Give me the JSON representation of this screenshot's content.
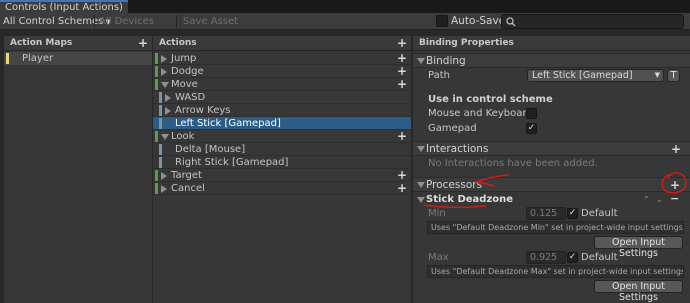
{
  "window": {
    "tab_title": "Controls (Input Actions)"
  },
  "toolbar": {
    "control_schemes": "All Control Schemes",
    "devices": "All Devices",
    "save_asset": "Save Asset",
    "auto_save": "Auto-Save",
    "auto_save_checked": false,
    "search_value": ""
  },
  "action_maps": {
    "title": "Action Maps",
    "items": [
      {
        "label": "Player",
        "color": "#e3dc7a"
      }
    ]
  },
  "actions": {
    "title": "Actions",
    "rows": [
      {
        "label": "Jump",
        "kind": "action",
        "expanded": false,
        "bar": "#5e9c4e"
      },
      {
        "label": "Dodge",
        "kind": "action",
        "expanded": false,
        "bar": "#5e9c4e"
      },
      {
        "label": "Move",
        "kind": "action",
        "expanded": true,
        "bar": "#5e9c4e"
      },
      {
        "label": "WASD",
        "kind": "composite",
        "expanded": false,
        "bar": "#7a95a6"
      },
      {
        "label": "Arrow Keys",
        "kind": "composite",
        "expanded": false,
        "bar": "#7a95a6"
      },
      {
        "label": "Left Stick [Gamepad]",
        "kind": "binding",
        "selected": true,
        "bar": "#7a95a6"
      },
      {
        "label": "Look",
        "kind": "action",
        "expanded": true,
        "bar": "#5e9c4e"
      },
      {
        "label": "Delta [Mouse]",
        "kind": "binding",
        "bar": "#7a95a6"
      },
      {
        "label": "Right Stick [Gamepad]",
        "kind": "binding",
        "bar": "#7a95a6"
      },
      {
        "label": "Target",
        "kind": "action",
        "expanded": false,
        "bar": "#5e9c4e"
      },
      {
        "label": "Cancel",
        "kind": "action",
        "expanded": false,
        "bar": "#5e9c4e"
      }
    ]
  },
  "properties": {
    "title": "Binding Properties",
    "binding": {
      "header": "Binding",
      "path_label": "Path",
      "path_value": "Left Stick [Gamepad]",
      "path_t_button": "T",
      "scheme_header": "Use in control scheme",
      "schemes": [
        {
          "label": "Mouse and Keyboard",
          "checked": false
        },
        {
          "label": "Gamepad",
          "checked": true
        }
      ]
    },
    "interactions": {
      "header": "Interactions",
      "empty": "No Interactions have been added."
    },
    "processors": {
      "header": "Processors",
      "item": {
        "name": "Stick Deadzone",
        "min_label": "Min",
        "min_value": "0.125",
        "min_default": "Default",
        "min_default_checked": true,
        "min_help": "Uses \"Default Deadzone Min\" set in project-wide input settings.",
        "open_settings": "Open Input Settings",
        "max_label": "Max",
        "max_value": "0.925",
        "max_default": "Default",
        "max_default_checked": true,
        "max_help": "Uses \"Default Deadzone Max\" set in project-wide input settings."
      }
    }
  },
  "colors": {
    "selection": "#2c5d87",
    "annotation": "#d11a1a"
  }
}
